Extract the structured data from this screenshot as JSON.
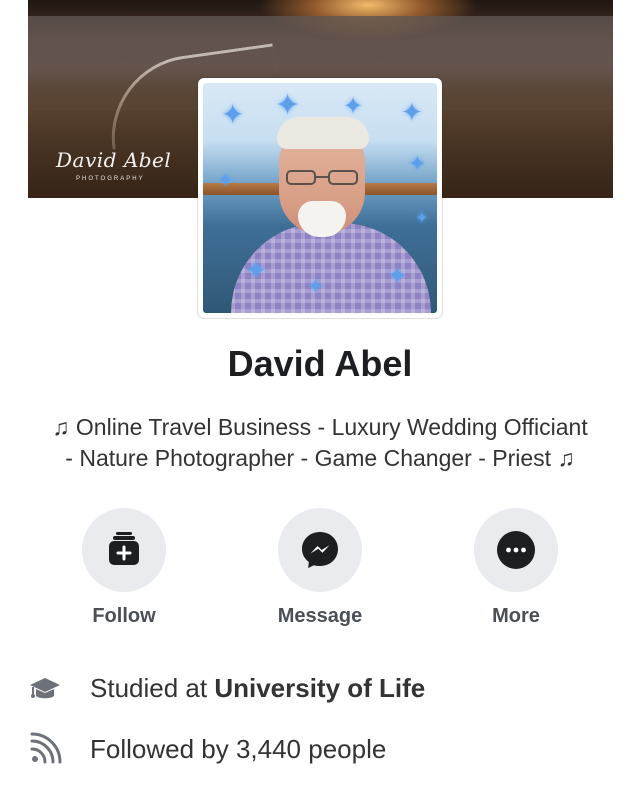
{
  "cover": {
    "signature": "David Abel",
    "signature_subtitle": "PHOTOGRAPHY"
  },
  "profile": {
    "name": "David Abel",
    "bio_line_1": "♫ Online Travel Business - Luxury Wedding Officiant",
    "bio_line_2": "- Nature Photographer - Game Changer - Priest ♫"
  },
  "actions": [
    {
      "label": "Follow",
      "icon": "add-follow-icon"
    },
    {
      "label": "Message",
      "icon": "messenger-icon"
    },
    {
      "label": "More",
      "icon": "more-dots-icon"
    }
  ],
  "info": {
    "education_prefix": "Studied at ",
    "education_school": "University of Life",
    "followers_text": "Followed by 3,440 people"
  },
  "colors": {
    "primary_text": "#1c1e21",
    "secondary_text": "#333333",
    "button_background": "#e9ebee",
    "icon_dark": "#1c1e21"
  }
}
